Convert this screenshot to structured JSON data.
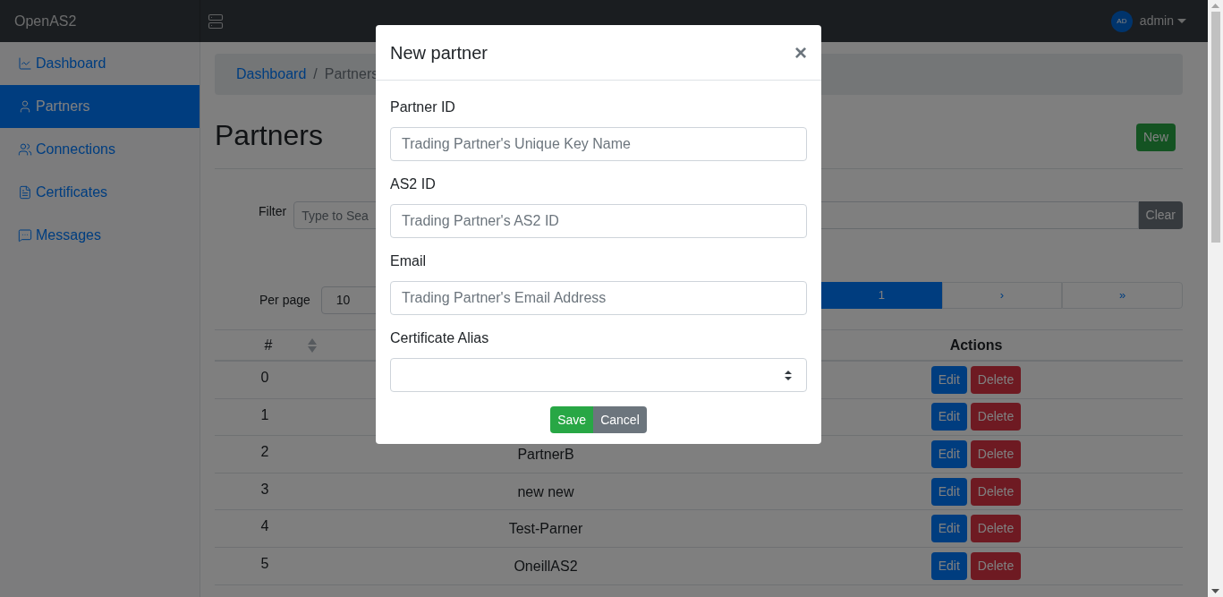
{
  "topbar": {
    "brand": "OpenAS2",
    "user": {
      "initials": "AD",
      "name": "admin"
    }
  },
  "sidebar": {
    "items": [
      {
        "label": "Dashboard",
        "selected": false
      },
      {
        "label": "Partners",
        "selected": true
      },
      {
        "label": "Connections",
        "selected": false
      },
      {
        "label": "Certificates",
        "selected": false
      },
      {
        "label": "Messages",
        "selected": false
      }
    ]
  },
  "breadcrumb": {
    "separator": "/",
    "items": [
      {
        "label": "Dashboard",
        "kind": "link"
      },
      {
        "label": "Partners",
        "kind": "current"
      }
    ]
  },
  "page": {
    "title": "Partners",
    "new_button": "New"
  },
  "filter": {
    "label": "Filter",
    "placeholder": "Type to Sea",
    "clear_button": "Clear"
  },
  "paging": {
    "label": "Per page",
    "per_page": "10",
    "pages": [
      {
        "label": "1",
        "selected": true
      },
      {
        "label": "›",
        "selected": false
      },
      {
        "label": "»",
        "selected": false
      }
    ]
  },
  "table": {
    "columns": [
      {
        "label": "#",
        "sortable": true
      },
      {
        "label": "Actions",
        "sortable": false
      }
    ],
    "rows": [
      {
        "index": "0",
        "actions": [
          {
            "label": "Edit",
            "kind": "edit"
          },
          {
            "label": "Delete",
            "kind": "delete"
          }
        ]
      },
      {
        "index": "1",
        "actions": [
          {
            "label": "Edit",
            "kind": "edit"
          },
          {
            "label": "Delete",
            "kind": "delete"
          }
        ]
      },
      {
        "index": "2",
        "name": "PartnerB",
        "actions": [
          {
            "label": "Edit",
            "kind": "edit"
          },
          {
            "label": "Delete",
            "kind": "delete"
          }
        ]
      },
      {
        "index": "3",
        "name": "new new",
        "actions": [
          {
            "label": "Edit",
            "kind": "edit"
          },
          {
            "label": "Delete",
            "kind": "delete"
          }
        ]
      },
      {
        "index": "4",
        "name": "Test-Parner",
        "actions": [
          {
            "label": "Edit",
            "kind": "edit"
          },
          {
            "label": "Delete",
            "kind": "delete"
          }
        ]
      },
      {
        "index": "5",
        "name": "OneillAS2",
        "actions": [
          {
            "label": "Edit",
            "kind": "edit"
          },
          {
            "label": "Delete",
            "kind": "delete"
          }
        ]
      }
    ]
  },
  "modal": {
    "title": "New partner",
    "close": "×",
    "fields": [
      {
        "label": "Partner ID",
        "kind": "text",
        "placeholder": "Trading Partner's Unique Key Name"
      },
      {
        "label": "AS2 ID",
        "kind": "text",
        "placeholder": "Trading Partner's AS2 ID"
      },
      {
        "label": "Email",
        "kind": "text",
        "placeholder": "Trading Partner's Email Address"
      },
      {
        "label": "Certificate Alias",
        "kind": "select"
      }
    ],
    "buttons": [
      {
        "label": "Save",
        "kind": "primary"
      },
      {
        "label": "Cancel",
        "kind": "secondary"
      }
    ]
  }
}
